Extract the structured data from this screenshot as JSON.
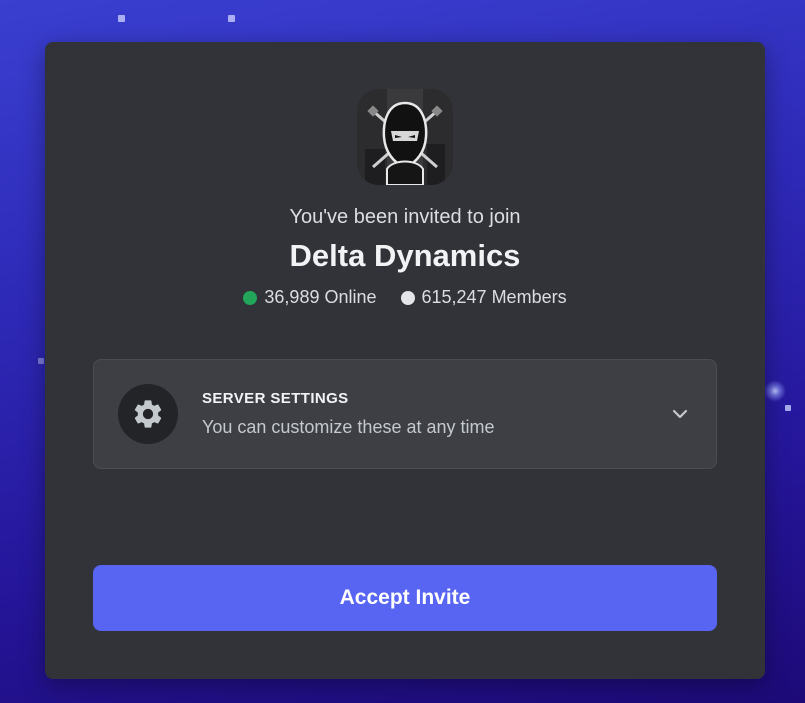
{
  "invite": {
    "intro_text": "You've been invited to join",
    "server_name": "Delta Dynamics",
    "online_count": "36,989 Online",
    "member_count": "615,247 Members"
  },
  "server_settings": {
    "title": "SERVER SETTINGS",
    "subtitle": "You can customize these at any time",
    "icon": "gear-icon",
    "expand_icon": "chevron-down-icon"
  },
  "actions": {
    "accept_label": "Accept Invite"
  },
  "colors": {
    "accent": "#5865f2",
    "online": "#23a55a",
    "modal_bg": "#313338"
  }
}
